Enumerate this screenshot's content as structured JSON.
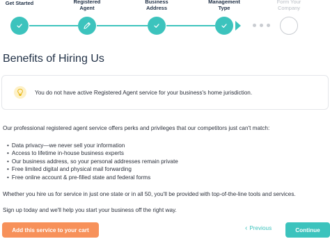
{
  "stepper": {
    "steps": [
      {
        "label": "Get Started",
        "state": "done",
        "icon": "check-icon"
      },
      {
        "label": "Registered Agent",
        "state": "current",
        "icon": "pencil-icon"
      },
      {
        "label": "Business Address",
        "state": "done",
        "icon": "check-icon"
      },
      {
        "label": "Management Type",
        "state": "done",
        "icon": "check-icon"
      },
      {
        "label": "Form Your Company",
        "state": "upcoming",
        "icon": ""
      }
    ]
  },
  "main": {
    "heading": "Benefits of Hiring Us",
    "alert": {
      "icon": "lightbulb-icon",
      "text": "You do not have active Registered Agent service for your business's home jurisdiction."
    },
    "intro": "Our professional registered agent service offers perks and privileges that our competitors just can't match:",
    "benefits": [
      "Data privacy—we never sell your information",
      "Access to lifetime in-house business experts",
      "Our business address, so your personal addresses remain private",
      "Free limited digital and physical mail forwarding",
      "Free online account & pre-filled state and federal forms"
    ],
    "paragraph_1": "Whether you hire us for service in just one state or in all 50, you'll be provided with top-of-the-line tools and services.",
    "paragraph_2": "Sign up today and we'll help you start your business off the right way."
  },
  "footer": {
    "add_to_cart_label": "Add this service to your cart",
    "previous_label": "Previous",
    "continue_label": "Continue"
  },
  "colors": {
    "teal": "#3cc3bd",
    "orange": "#f7915a",
    "text": "#2a2f3a",
    "upcoming": "#c9ccd1"
  }
}
